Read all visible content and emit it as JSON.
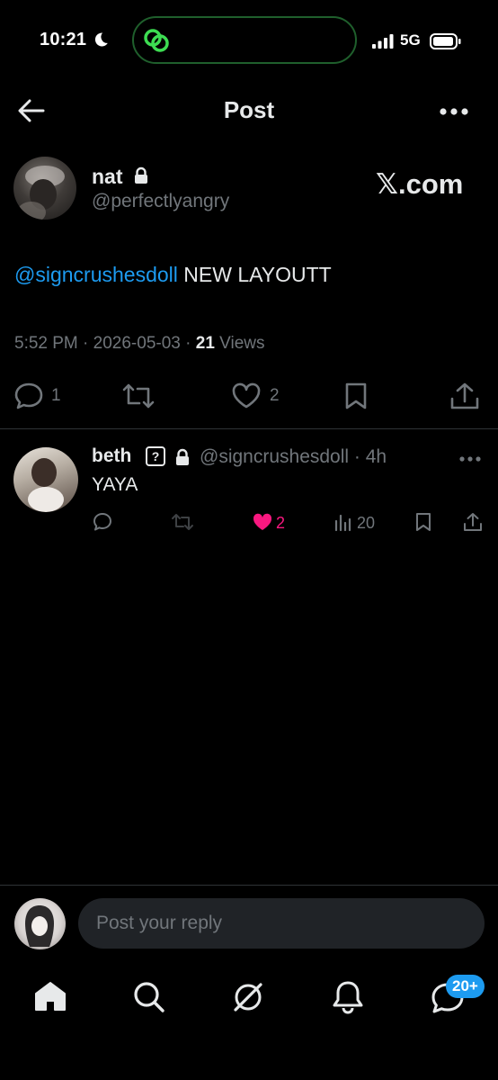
{
  "status": {
    "time": "10:21",
    "network": "5G"
  },
  "header": {
    "title": "Post"
  },
  "post": {
    "author_name": "nat",
    "author_handle": "@perfectlyangry",
    "watermark": "𝕏.com",
    "mention": "@signcrushesdoll",
    "text": " NEW LAYOUTT",
    "time": "5:52 PM",
    "date": "2026-05-03",
    "views_count": "21",
    "views_label": "Views",
    "reply_count": "1",
    "like_count": "2"
  },
  "reply": {
    "name": "beth",
    "badge": "?",
    "handle": "@signcrushesdoll",
    "age": "4h",
    "text": "YAYA",
    "like_count": "2",
    "view_count": "20"
  },
  "composer": {
    "placeholder": "Post your reply"
  },
  "nav": {
    "messages_badge": "20+"
  },
  "colors": {
    "accent": "#1d9bf0",
    "like": "#f91880",
    "muted": "#71767b",
    "island_border": "#1f5f2c",
    "island_icon": "#3ddc52"
  }
}
